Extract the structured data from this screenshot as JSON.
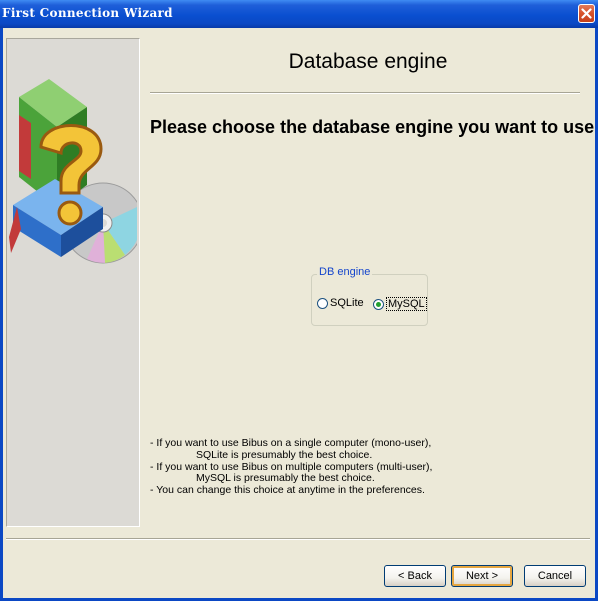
{
  "window": {
    "title": "First Connection Wizard",
    "close_icon": "close-icon"
  },
  "page": {
    "heading": "Database engine",
    "subheading": "Please choose the database engine you want to use"
  },
  "db_engine": {
    "legend": "DB engine",
    "options": [
      {
        "label": "SQLite",
        "selected": false
      },
      {
        "label": "MySQL",
        "selected": true
      }
    ]
  },
  "info_lines": [
    "- If you want to use Bibus on a single computer (mono-user),",
    "SQLite is presumably the best choice.",
    "- If you want to use Bibus on multiple computers (multi-user),",
    "MySQL is presumably the best choice.",
    "- You can change this choice at anytime in the preferences."
  ],
  "buttons": {
    "back": "< Back",
    "next": "Next >",
    "cancel": "Cancel"
  },
  "colors": {
    "titlebar": "#0b48c4",
    "legend_text": "#1445cc",
    "radio_dot": "#23a031",
    "default_button_ring": "#e5a640"
  }
}
